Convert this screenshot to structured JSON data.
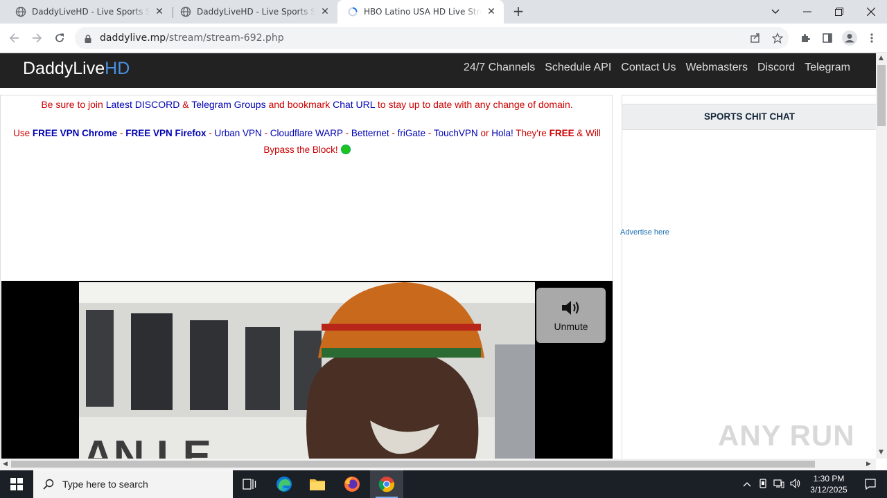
{
  "browser": {
    "tabs": [
      {
        "title": "DaddyLiveHD - Live Sports Streaming",
        "active": false
      },
      {
        "title": "DaddyLiveHD - Live Sports Streaming",
        "active": false
      },
      {
        "title": "HBO Latino USA HD Live Streaming",
        "active": true
      }
    ],
    "url_host": "daddylive.mp",
    "url_path": "/stream/stream-692.php"
  },
  "site": {
    "brand_main": "DaddyLive",
    "brand_accent": "HD",
    "nav": [
      "24/7 Channels",
      "Schedule API",
      "Contact Us",
      "Webmasters",
      "Discord",
      "Telegram"
    ],
    "notice1": {
      "p1": "Be sure to join ",
      "link1": "Latest DISCORD",
      "p2": " & ",
      "link2": "Telegram Groups",
      "p3": " and bookmark ",
      "link3": "Chat URL",
      "p4": " to stay up to date with any change of domain."
    },
    "notice2": {
      "p0": "Use ",
      "vpn1": "FREE VPN Chrome",
      "s1": " - ",
      "vpn2": "FREE VPN Firefox",
      "s2": " - ",
      "vpn3": "Urban VPN",
      "s3": " - ",
      "vpn4": "Cloudflare WARP",
      "s4": " - ",
      "vpn5": "Betternet",
      "s5": " - ",
      "vpn6": "friGate",
      "s6": " - ",
      "vpn7": "TouchVPN",
      "s7": " or ",
      "vpn8": "Hola!",
      "p1": " They're ",
      "free": "FREE",
      "p2": " & Will Bypass the Block!"
    },
    "unmute_label": "Unmute",
    "sidebar_title": "SPORTS CHIT CHAT",
    "advertise": "Advertise here",
    "watermark": "ANY RUN"
  },
  "taskbar": {
    "search_placeholder": "Type here to search",
    "time": "1:30 PM",
    "date": "3/12/2025"
  },
  "colors": {
    "nav_bg": "#222222",
    "brand_accent": "#4a90e2",
    "notice_red": "#cc0000",
    "notice_blue": "#0000b3"
  }
}
